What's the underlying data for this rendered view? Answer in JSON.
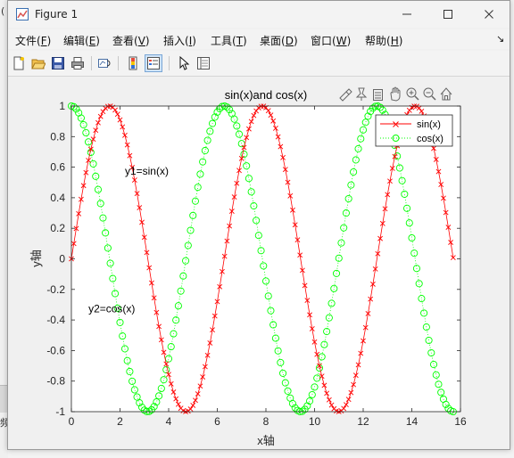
{
  "window": {
    "title": "Figure 1",
    "left_edge_char": "(",
    "left_edge_char_bottom": "频"
  },
  "menu": [
    {
      "label": "文件",
      "key": "F"
    },
    {
      "label": "编辑",
      "key": "E"
    },
    {
      "label": "查看",
      "key": "V"
    },
    {
      "label": "插入",
      "key": "I"
    },
    {
      "label": "工具",
      "key": "T"
    },
    {
      "label": "桌面",
      "key": "D"
    },
    {
      "label": "窗口",
      "key": "W"
    },
    {
      "label": "帮助",
      "key": "H"
    }
  ],
  "menu_overflow": "↘",
  "toolbar": [
    "new-figure-icon",
    "open-file-icon",
    "save-icon",
    "print-icon",
    "link-plot-icon",
    "insert-colorbar-icon",
    "insert-legend-icon",
    "edit-plot-arrow-icon",
    "property-inspector-icon"
  ],
  "axes_toolbar": [
    "brush-icon",
    "data-tips-icon",
    "rotate-icon",
    "pan-icon",
    "zoom-in-icon",
    "zoom-out-icon",
    "home-icon"
  ],
  "colors": {
    "sin": "#ff0000",
    "cos": "#00ff00",
    "axes_bg": "#ffffff",
    "window_bg": "#f0f0f0"
  },
  "chart_data": {
    "type": "line",
    "title": "sin(x)and cos(x)",
    "xlabel": "x轴",
    "ylabel": "y轴",
    "xlim": [
      0,
      16
    ],
    "ylim": [
      -1,
      1
    ],
    "xticks": [
      "0",
      "2",
      "4",
      "6",
      "8",
      "10",
      "12",
      "14",
      "16"
    ],
    "yticks": [
      "-1",
      "-0.8",
      "-0.6",
      "-0.4",
      "-0.2",
      "0",
      "0.2",
      "0.4",
      "0.6",
      "0.8",
      "1"
    ],
    "x": {
      "start": 0,
      "end": 15.7,
      "step": 0.1
    },
    "series": [
      {
        "name": "sin(x)",
        "function": "sin(x)",
        "color": "#ff0000",
        "marker": "x",
        "line": "solid"
      },
      {
        "name": "cos(x)",
        "function": "cos(x)",
        "color": "#00ff00",
        "marker": "o",
        "line": "dotted"
      }
    ],
    "annotations": [
      {
        "text": "y1=sin(x)",
        "x": 2.2,
        "y": 0.55
      },
      {
        "text": "y2=cos(x)",
        "x": 0.7,
        "y": -0.35
      }
    ],
    "legend": "top-right",
    "grid": false
  }
}
